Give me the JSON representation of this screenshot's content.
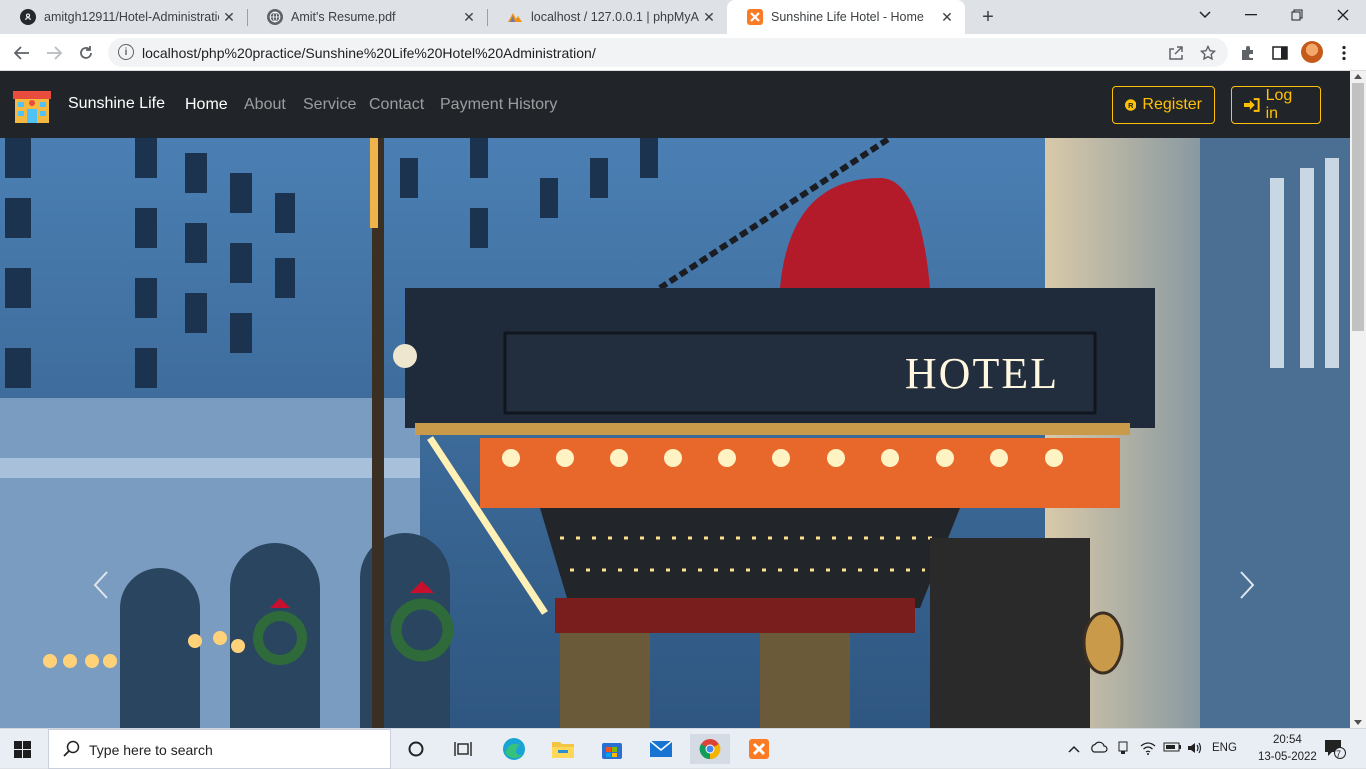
{
  "browser": {
    "tabs": [
      {
        "title": "amitgh12911/Hotel-Administratio",
        "icon": "github-icon",
        "active": false
      },
      {
        "title": "Amit's Resume.pdf",
        "icon": "globe-icon",
        "active": false
      },
      {
        "title": "localhost / 127.0.0.1 | phpMyAdm",
        "icon": "phpmyadmin-icon",
        "active": false
      },
      {
        "title": "Sunshine Life Hotel - Home",
        "icon": "xampp-icon",
        "active": true
      }
    ],
    "url": "localhost/php%20practice/Sunshine%20Life%20Hotel%20Administration/"
  },
  "site": {
    "brand": "Sunshine Life",
    "nav": [
      "Home",
      "About",
      "Service",
      "Contact",
      "Payment History"
    ],
    "register_label": "Register",
    "login_label": "Log in",
    "hero_sign": "HOTEL",
    "accent_color": "#ffc107",
    "navbar_color": "#212529"
  },
  "taskbar": {
    "search_placeholder": "Type here to search",
    "lang": "ENG",
    "time": "20:54",
    "date": "13-05-2022",
    "notifications": "7"
  }
}
